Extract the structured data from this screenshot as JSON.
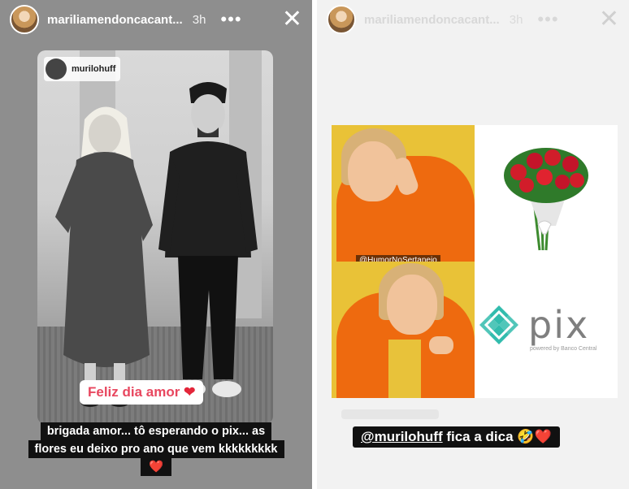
{
  "left_story": {
    "username": "mariliamendoncacant...",
    "time": "3h",
    "menu_icon": "more-dots-icon",
    "close_icon": "close-icon",
    "photo": {
      "tag_username": "murilohuff",
      "sticker_text": "Feliz dia amor",
      "sticker_emoji": "❤"
    },
    "comment_lines": [
      "brigada amor... tô esperando o pix... as",
      "flores eu deixo pro ano que vem kkkkkkkkk"
    ],
    "comment_emoji": "❤️"
  },
  "right_story": {
    "username": "mariliamendoncacant...",
    "time": "3h",
    "menu_icon": "more-dots-icon",
    "close_icon": "close-icon",
    "meme": {
      "watermark": "@HumorNoSertanejo",
      "pix_text": "pix",
      "pix_subtext": "powered by Banco Central"
    },
    "caption_mention": "@murilohuff",
    "caption_text": " fica a dica ",
    "caption_emojis": "🤣❤️"
  },
  "colors": {
    "left_background": "#8e8e8e",
    "right_background": "#f2f2f2",
    "meme_yellow": "#e9c237",
    "jacket_orange": "#ee6a0f",
    "pix_teal": "#32bcad",
    "heart_red": "#e3263a"
  }
}
